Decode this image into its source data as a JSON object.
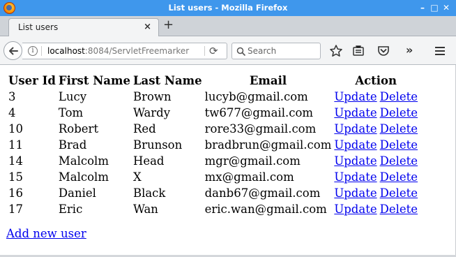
{
  "window": {
    "title": "List users - Mozilla Firefox",
    "minimize_label": "–",
    "maximize_label": "□",
    "close_label": "✕"
  },
  "tabs": [
    {
      "label": "List users",
      "close_label": "×"
    }
  ],
  "newtab_label": "+",
  "navbar": {
    "url_host": "localhost",
    "url_rest": ":8084/ServletFreemarker",
    "reload_label": "⟳",
    "search_placeholder": "Search",
    "overflow_label": "»"
  },
  "table": {
    "headers": [
      "User Id",
      "First Name",
      "Last Name",
      "Email",
      "Action"
    ],
    "rows": [
      {
        "id": "3",
        "first": "Lucy",
        "last": "Brown",
        "email": "lucyb@gmail.com",
        "update": "Update",
        "delete": "Delete"
      },
      {
        "id": "4",
        "first": "Tom",
        "last": "Wardy",
        "email": "tw677@gmail.com",
        "update": "Update",
        "delete": "Delete"
      },
      {
        "id": "10",
        "first": "Robert",
        "last": "Red",
        "email": "rore33@gmail.com",
        "update": "Update",
        "delete": "Delete"
      },
      {
        "id": "11",
        "first": "Brad",
        "last": "Brunson",
        "email": "bradbrun@gmail.com",
        "update": "Update",
        "delete": "Delete"
      },
      {
        "id": "14",
        "first": "Malcolm",
        "last": "Head",
        "email": "mgr@gmail.com",
        "update": "Update",
        "delete": "Delete"
      },
      {
        "id": "15",
        "first": "Malcolm",
        "last": "X",
        "email": "mx@gmail.com",
        "update": "Update",
        "delete": "Delete"
      },
      {
        "id": "16",
        "first": "Daniel",
        "last": "Black",
        "email": "danb67@gmail.com",
        "update": "Update",
        "delete": "Delete"
      },
      {
        "id": "17",
        "first": "Eric",
        "last": "Wan",
        "email": "eric.wan@gmail.com",
        "update": "Update",
        "delete": "Delete"
      }
    ]
  },
  "add_link": "Add new user",
  "colors": {
    "titlebar": "#3f97ec",
    "link": "#0000ee",
    "toolbar": "#f3f4f5"
  },
  "icons": [
    "firefox-logo-icon",
    "back-arrow-icon",
    "info-icon",
    "reload-icon",
    "search-icon",
    "star-icon",
    "reading-list-icon",
    "pocket-icon",
    "overflow-icon",
    "hamburger-menu-icon"
  ]
}
